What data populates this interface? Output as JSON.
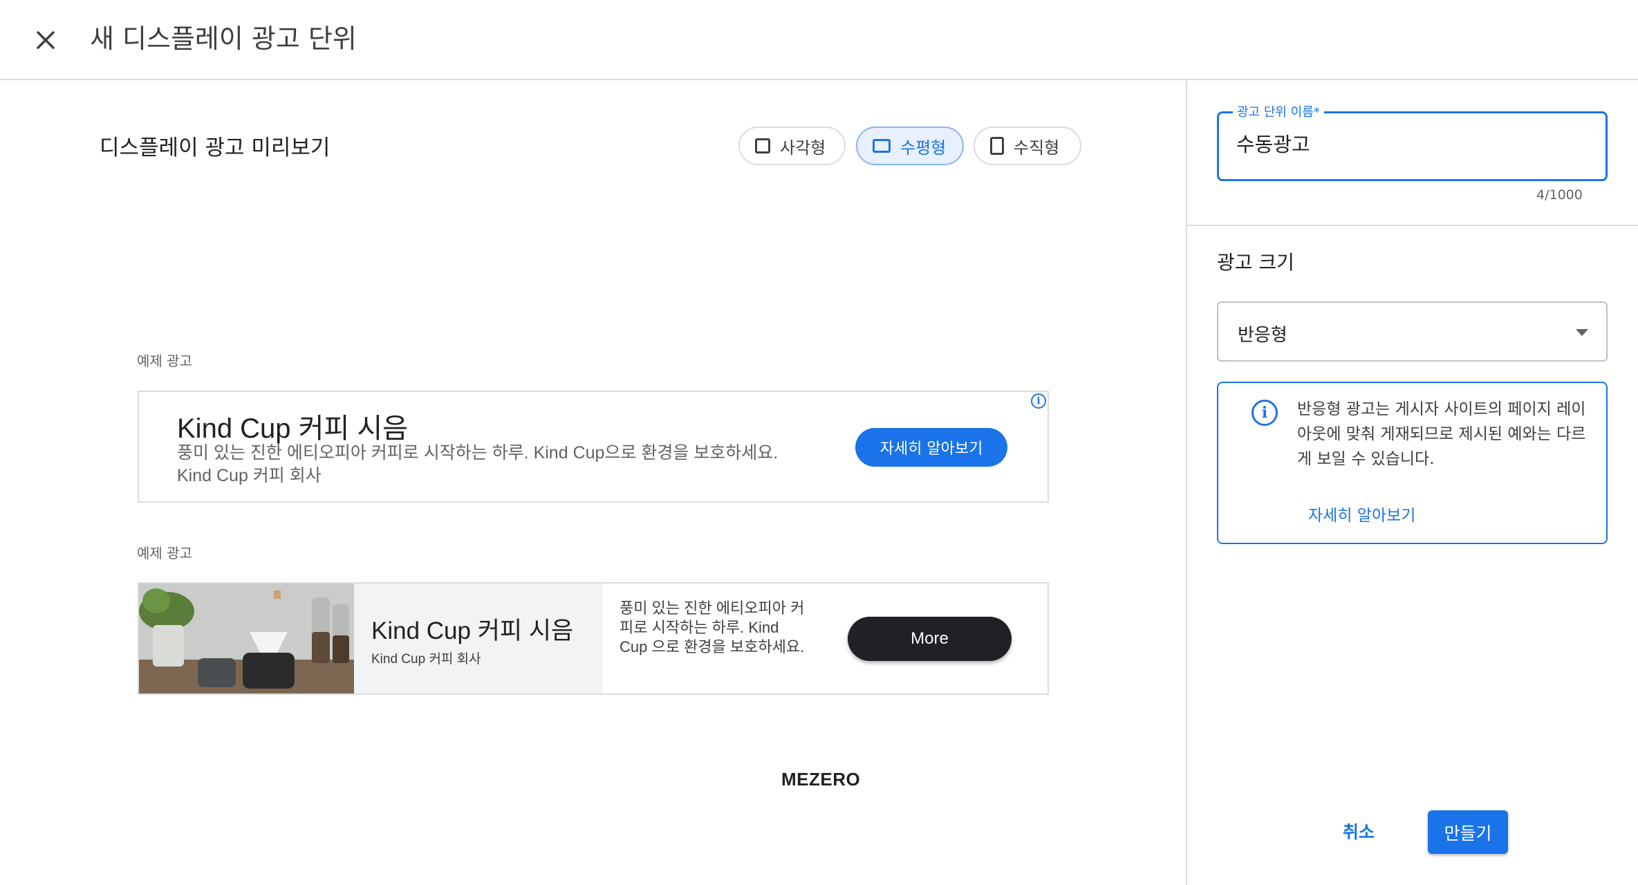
{
  "header": {
    "close_icon": "close-icon",
    "title": "새 디스플레이 광고 단위"
  },
  "preview": {
    "title": "디스플레이 광고 미리보기",
    "shapes": [
      {
        "label": "사각형",
        "icon": "square-icon",
        "selected": false
      },
      {
        "label": "수평형",
        "icon": "horizontal-rectangle-icon",
        "selected": true
      },
      {
        "label": "수직형",
        "icon": "vertical-rectangle-icon",
        "selected": false
      }
    ],
    "sample_label_1": "예제 광고",
    "sample_label_2": "예제 광고",
    "ad1": {
      "title": "Kind Cup 커피 시음",
      "description": "풍미 있는 진한 에티오피아 커피로 시작하는 하루. Kind Cup으로 환경을 보호하세요. Kind Cup 커피 회사",
      "cta": "자세히 알아보기",
      "adchoices": "i"
    },
    "ad2": {
      "title": "Kind Cup 커피 시음",
      "subtitle": "Kind Cup 커피 회사",
      "description": "풍미 있는 진한 에티오피아 커피로 시작하는 하루. Kind Cup 으로 환경을 보호하세요.",
      "cta": "More"
    },
    "brand": "MEZERO"
  },
  "settings": {
    "name_label": "광고 단위 이름*",
    "name_value": "수동광고",
    "name_counter": "4/1000",
    "size_title": "광고 크기",
    "size_value": "반응형",
    "info_icon": "info-icon",
    "info_text": "반응형 광고는 게시자 사이트의 페이지 레이아웃에 맞춰 게재되므로 제시된 예와는 다르게 보일 수 있습니다.",
    "info_link": "자세히 알아보기",
    "cancel": "취소",
    "create": "만들기"
  },
  "colors": {
    "accent": "#1a73e8",
    "chip_selected_bg": "#e8f0fe",
    "dark_button": "#202124",
    "divider": "#dadce0"
  }
}
